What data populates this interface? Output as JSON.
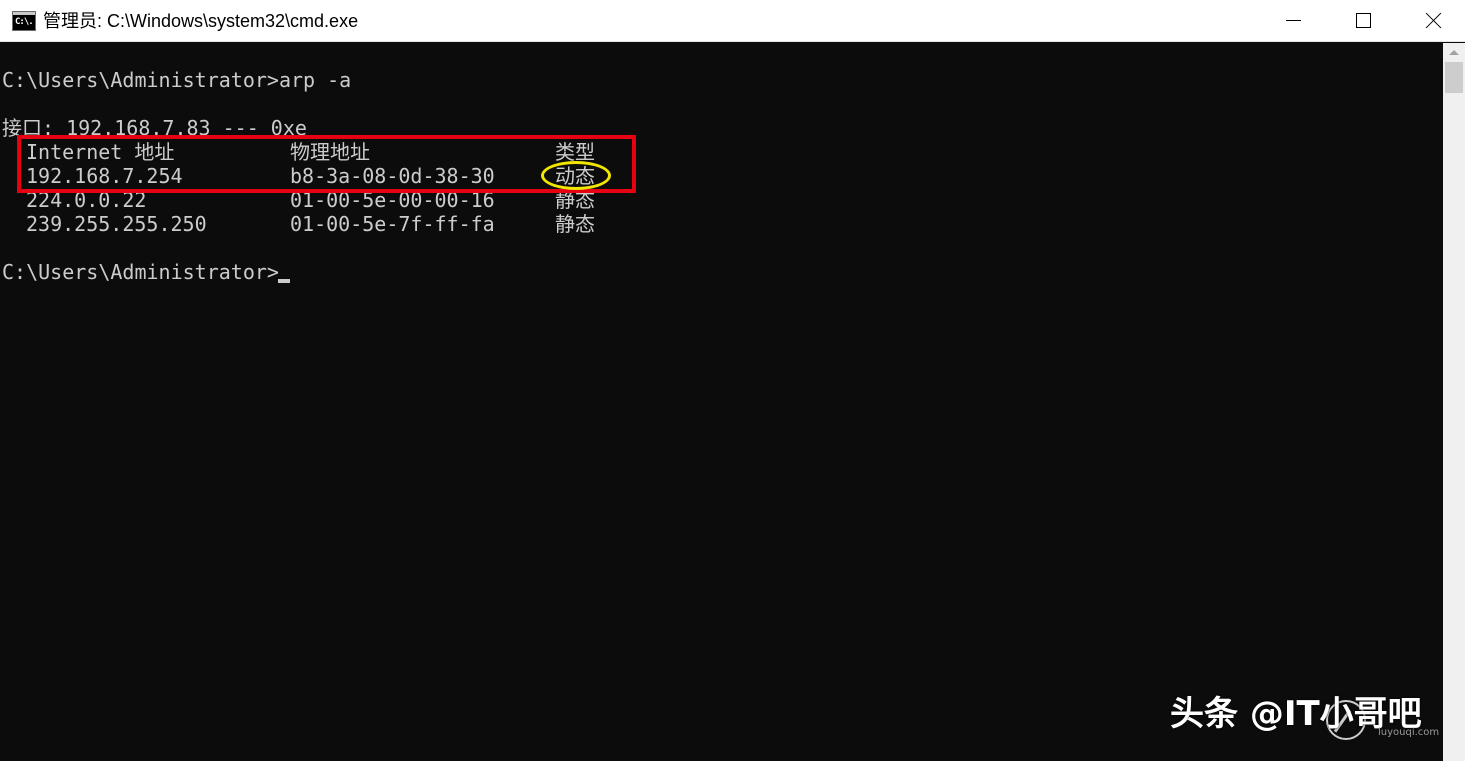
{
  "window": {
    "title": "管理员: C:\\Windows\\system32\\cmd.exe",
    "icon": "cmd-icon",
    "icon_label": "C:\\."
  },
  "controls": {
    "minimize": "minimize-icon",
    "maximize": "maximize-icon",
    "close": "close-icon"
  },
  "console": {
    "command_line": "C:\\Users\\Administrator>arp -a",
    "interface_line": "接口: 192.168.7.83 --- 0xe",
    "table": {
      "headers": [
        "Internet 地址",
        "物理地址",
        "类型"
      ],
      "rows": [
        [
          "192.168.7.254",
          "b8-3a-08-0d-38-30",
          "动态"
        ],
        [
          "224.0.0.22",
          "01-00-5e-00-00-16",
          "静态"
        ],
        [
          "239.255.255.250",
          "01-00-5e-7f-ff-fa",
          "静态"
        ]
      ]
    },
    "prompt": "C:\\Users\\Administrator>"
  },
  "annotations": {
    "highlight_box_color": "#e60012",
    "highlight_ring_color": "#f2e600"
  },
  "colors": {
    "console_bg": "#0c0c0c",
    "console_text": "#cccccc",
    "titlebar_bg": "#ffffff"
  },
  "watermark": {
    "text": "头条 @IT小哥吧",
    "site": "luyouqi.com"
  }
}
